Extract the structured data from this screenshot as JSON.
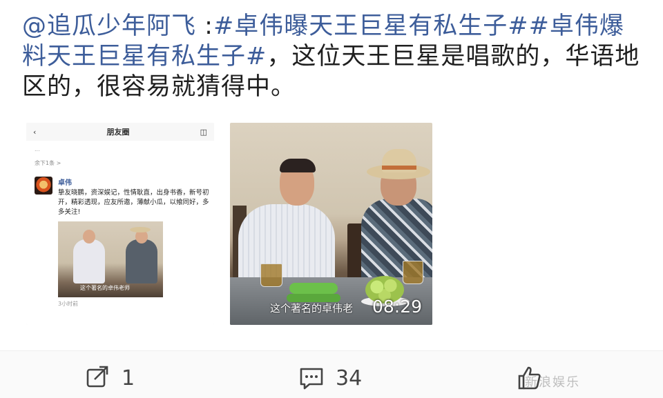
{
  "post": {
    "mention": "@追瓜少年阿飞",
    "separator": " :",
    "topic1": "#卓伟曝天王巨星有私生子#",
    "topic2": "#卓伟爆料天王巨星有私生子#",
    "body": "，这位天王巨星是唱歌的，华语地区的，很容易就猜得中。"
  },
  "image1": {
    "header_title": "朋友圈",
    "faded_line": "...",
    "more_link": "余下1条 >",
    "author": "卓伟",
    "text": "挚友晓鹏，资深娱记，性情耿直，出身书香，新号初开，精彩透现，应友所邀，薄献小瓜，以飨同好，多多关注!",
    "photo_caption": "这个著名的卓伟老师",
    "time": "3小时前"
  },
  "image2": {
    "subtitle": "这个著名的卓伟老",
    "duration": "08:29"
  },
  "actions": {
    "repost_count": "1",
    "comment_count": "34"
  },
  "watermark": "新浪娱乐"
}
